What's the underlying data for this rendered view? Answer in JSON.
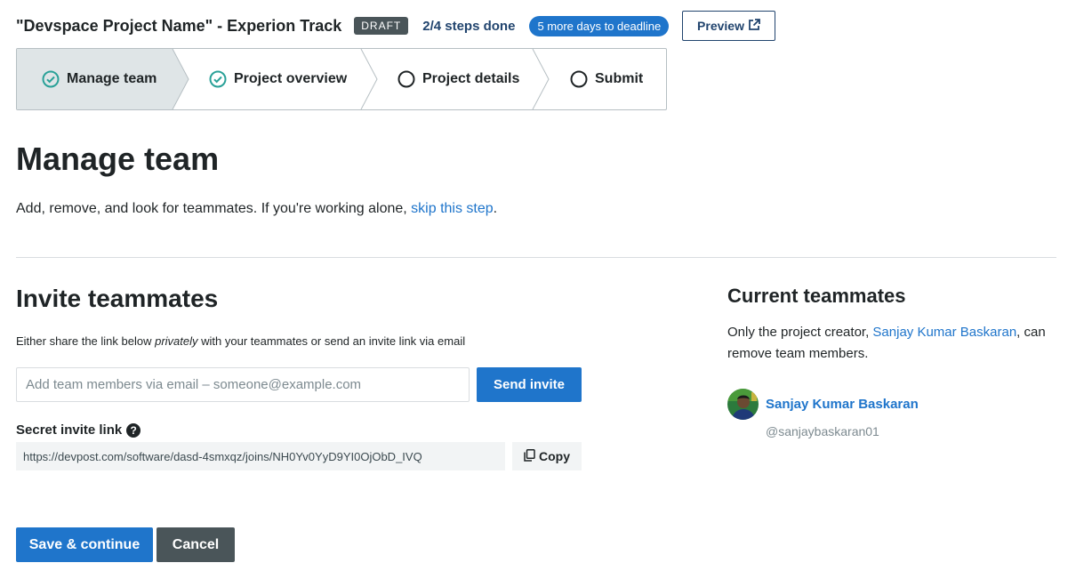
{
  "header": {
    "project_title": "\"Devspace Project Name\" - Experion Track",
    "status_badge": "DRAFT",
    "steps_done": "2/4 steps done",
    "deadline": "5 more days to deadline",
    "preview_label": "Preview"
  },
  "stepper": {
    "steps": [
      {
        "label": "Manage team",
        "state": "completed",
        "active": true
      },
      {
        "label": "Project overview",
        "state": "completed",
        "active": false
      },
      {
        "label": "Project details",
        "state": "pending",
        "active": false
      },
      {
        "label": "Submit",
        "state": "pending",
        "active": false
      }
    ]
  },
  "main": {
    "title": "Manage team",
    "intro_text": "Add, remove, and look for teammates. If you're working alone, ",
    "intro_link": "skip this step",
    "intro_end": "."
  },
  "invite": {
    "title": "Invite teammates",
    "desc_before": "Either share the link below ",
    "desc_em": "privately",
    "desc_after": " with your teammates or send an invite link via email",
    "email_placeholder": "Add team members via email – someone@example.com",
    "email_value": "",
    "send_label": "Send invite",
    "secret_label": "Secret invite link",
    "secret_link": "https://devpost.com/software/dasd-4smxqz/joins/NH0Yv0YyD9YI0OjObD_IVQ",
    "copy_label": "Copy"
  },
  "actions": {
    "save_label": "Save & continue",
    "cancel_label": "Cancel"
  },
  "current": {
    "title": "Current teammates",
    "desc_before": "Only the project creator, ",
    "creator_link": "Sanjay Kumar Baskaran",
    "desc_after": ", can remove team members.",
    "members": [
      {
        "name": "Sanjay Kumar Baskaran",
        "handle": "@sanjaybaskaran01"
      }
    ]
  },
  "colors": {
    "accent": "#1f75cb",
    "navy": "#21446e",
    "dark_gray": "#4a5559",
    "success": "#2aa198",
    "active_step_bg": "#dfe5e7"
  },
  "icons": {
    "preview": "external-link-icon",
    "step_completed": "check-circle-icon",
    "step_pending": "empty-circle-icon",
    "help": "question-circle-icon",
    "copy": "copy-icon"
  }
}
